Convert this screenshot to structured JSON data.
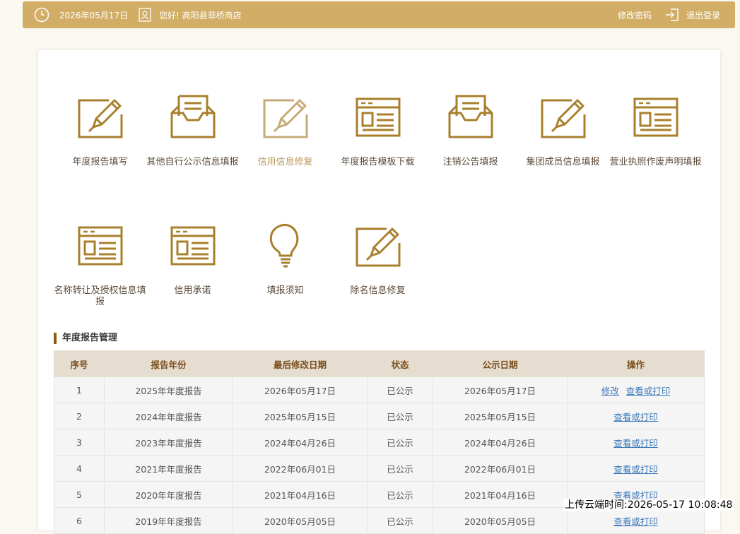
{
  "header": {
    "date": "2026年05月17日",
    "greeting": "您好! 高阳县菲桥商店",
    "change_password": "修改密码",
    "logout": "退出登录"
  },
  "functions": [
    {
      "label": "年度报告填写",
      "icon": "edit-icon"
    },
    {
      "label": "其他自行公示信息填报",
      "icon": "inbox-icon"
    },
    {
      "label": "信用信息修复",
      "icon": "edit-icon"
    },
    {
      "label": "年度报告模板下载",
      "icon": "form-icon"
    },
    {
      "label": "注销公告填报",
      "icon": "inbox-icon"
    },
    {
      "label": "集团成员信息填报",
      "icon": "edit-icon"
    },
    {
      "label": "营业执照作废声明填报",
      "icon": "form-icon"
    },
    {
      "label": "名称转让及授权信息填报",
      "icon": "form-icon"
    },
    {
      "label": "信用承诺",
      "icon": "form-icon"
    },
    {
      "label": "填报须知",
      "icon": "lightbulb-icon"
    },
    {
      "label": "除名信息修复",
      "icon": "edit-icon"
    }
  ],
  "section_title": "年度报告管理",
  "table": {
    "headers": [
      "序号",
      "报告年份",
      "最后修改日期",
      "状态",
      "公示日期",
      "操作"
    ],
    "rows": [
      {
        "no": "1",
        "year": "2025年年度报告",
        "modified": "2026年05月17日",
        "status": "已公示",
        "published": "2026年05月17日",
        "actions": [
          "修改",
          "查看或打印"
        ]
      },
      {
        "no": "2",
        "year": "2024年年度报告",
        "modified": "2025年05月15日",
        "status": "已公示",
        "published": "2025年05月15日",
        "actions": [
          "查看或打印"
        ]
      },
      {
        "no": "3",
        "year": "2023年年度报告",
        "modified": "2024年04月26日",
        "status": "已公示",
        "published": "2024年04月26日",
        "actions": [
          "查看或打印"
        ]
      },
      {
        "no": "4",
        "year": "2021年年度报告",
        "modified": "2022年06月01日",
        "status": "已公示",
        "published": "2022年06月01日",
        "actions": [
          "查看或打印"
        ]
      },
      {
        "no": "5",
        "year": "2020年年度报告",
        "modified": "2021年04月16日",
        "status": "已公示",
        "published": "2021年04月16日",
        "actions": [
          "查看或打印"
        ]
      },
      {
        "no": "6",
        "year": "2019年年度报告",
        "modified": "2020年05月05日",
        "status": "已公示",
        "published": "2020年05月05日",
        "actions": [
          "查看或打印"
        ]
      }
    ]
  },
  "upload_stamp": "上传云端时间:2026-05-17 10:08:48"
}
